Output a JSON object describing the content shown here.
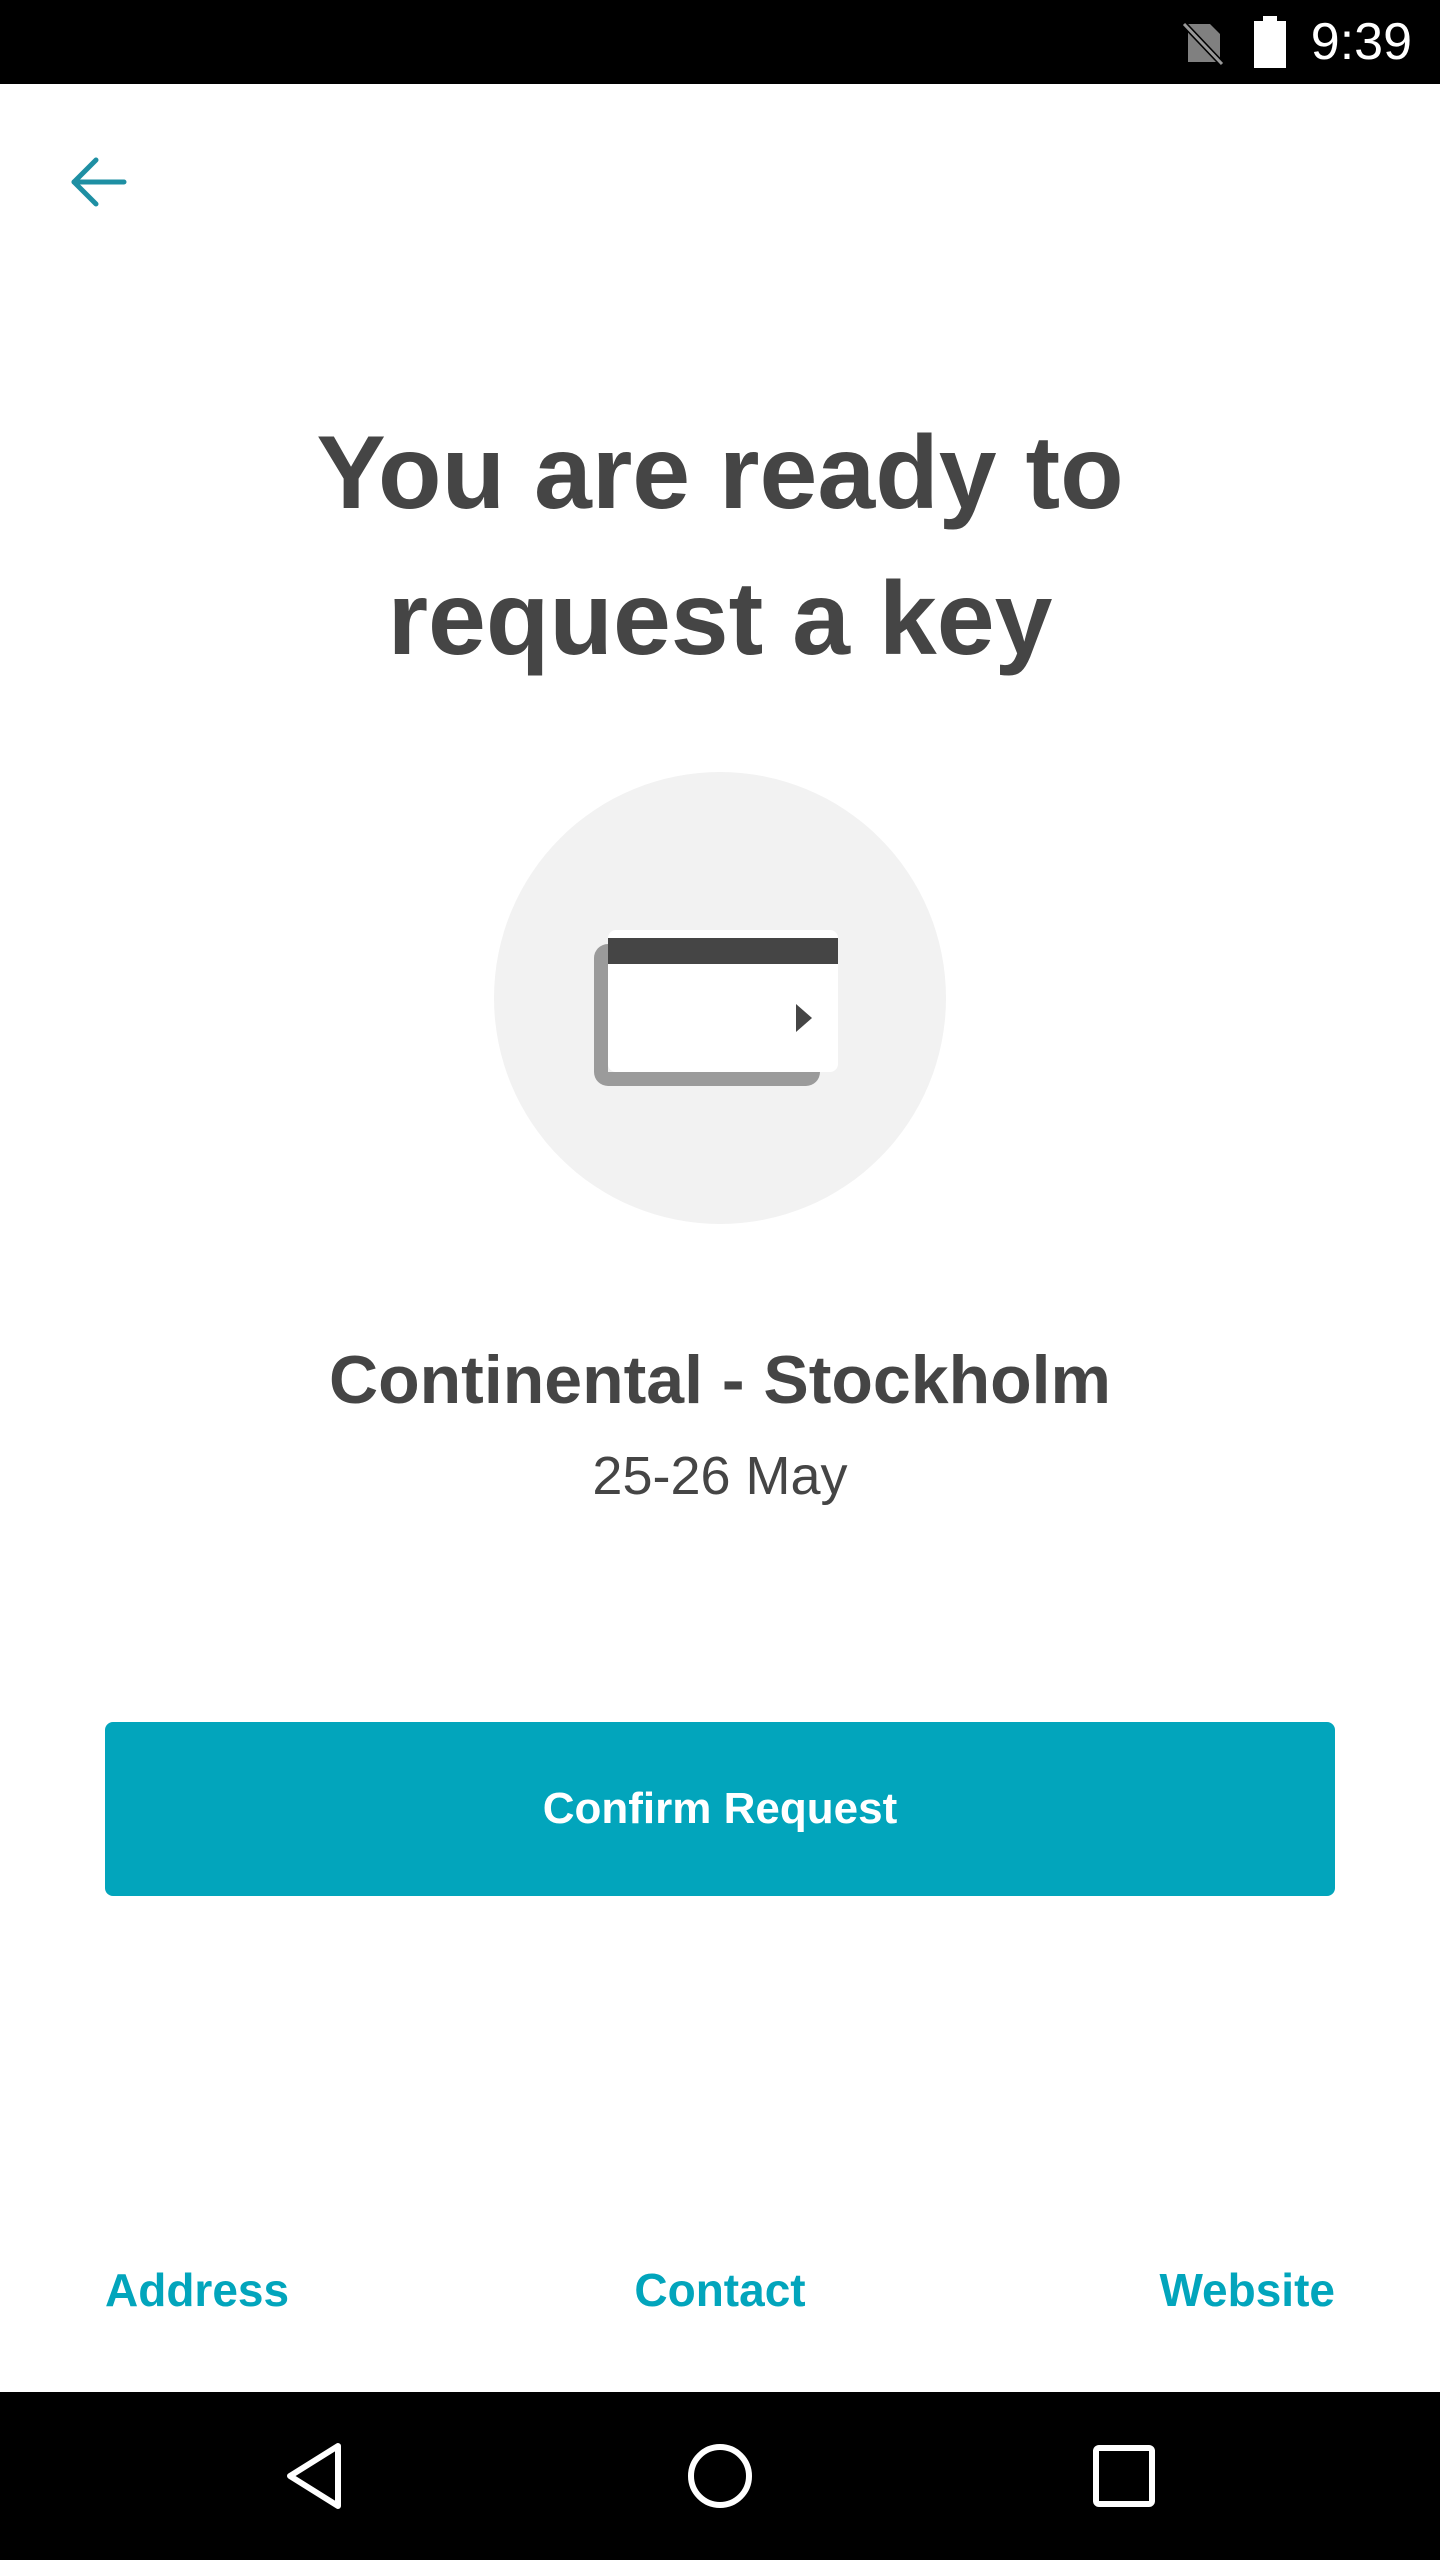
{
  "status_bar": {
    "time": "9:39",
    "icons": [
      "no-sim-icon",
      "battery-icon"
    ]
  },
  "header": {
    "back_icon": "arrow-left-icon"
  },
  "main": {
    "title": "You are ready to request a key",
    "illustration_icon": "key-card-icon",
    "hotel_name": "Continental - Stockholm",
    "dates": "25-26 May",
    "confirm_label": "Confirm Request"
  },
  "footer": {
    "links": [
      {
        "label": "Address"
      },
      {
        "label": "Contact"
      },
      {
        "label": "Website"
      }
    ]
  },
  "nav_bar": {
    "icons": [
      "nav-back-icon",
      "nav-home-icon",
      "nav-recents-icon"
    ]
  },
  "colors": {
    "accent": "#02a5bc",
    "text_primary": "#454545",
    "illustration_bg": "#f2f2f2",
    "system_bars": "#000000"
  }
}
